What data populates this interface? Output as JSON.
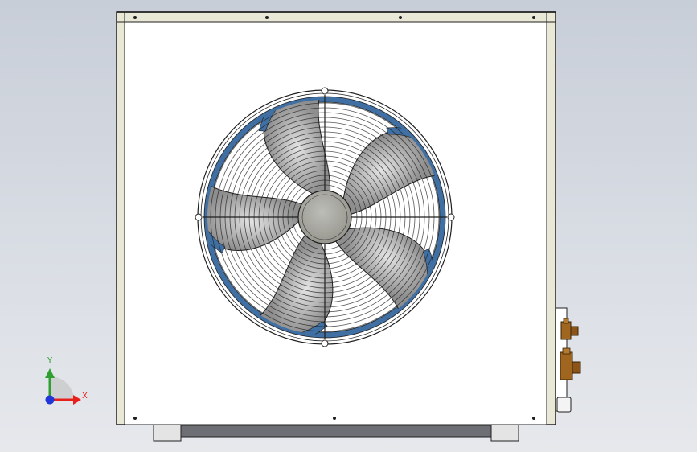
{
  "viewport": {
    "background_top": "#c8ced8",
    "background_bottom": "#e6e8ec"
  },
  "model": {
    "component": "outdoor-ac-unit",
    "panel_color": "#ffffff",
    "frame_color": "#e9e8d6",
    "edge_color": "#2a2a2a",
    "fan": {
      "blade_count": 5,
      "guard_rings": 18,
      "ring_color": "#3f6fa3",
      "blade_color": "#9a9a9a",
      "hub_color": "#a6a6a1"
    },
    "valves": {
      "count": 2,
      "color": "#a0651f"
    }
  },
  "triad": {
    "x_label": "X",
    "y_label": "Y",
    "x_color": "#e8201c",
    "y_color": "#2fa02f",
    "z_color": "#2036d8"
  }
}
